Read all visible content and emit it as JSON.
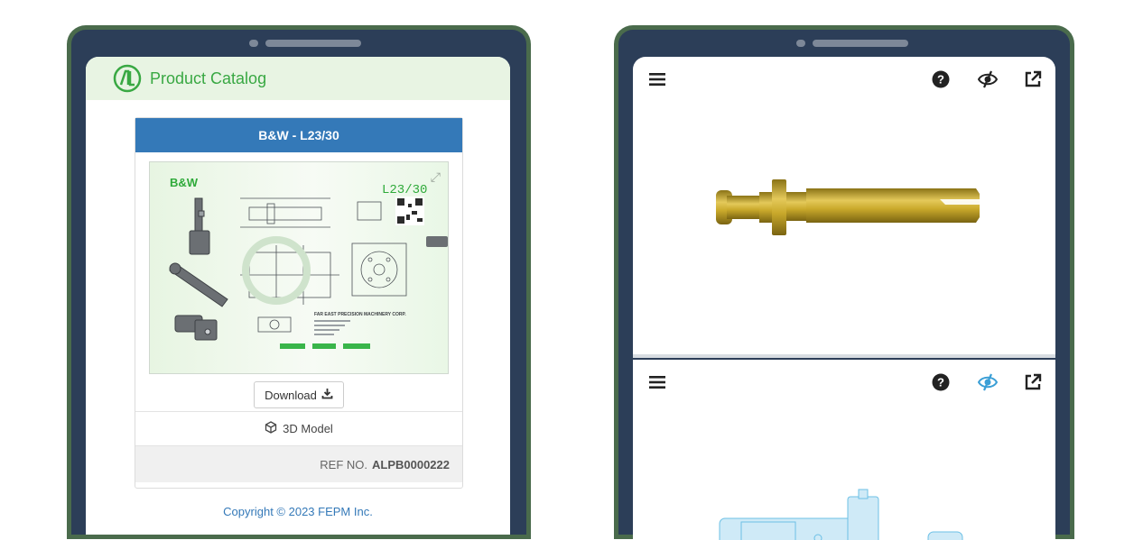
{
  "catalog": {
    "app_title": "Product Catalog",
    "product_title": "B&W - L23/30",
    "drawing": {
      "brand": "B&W",
      "model_code": "L23/30",
      "corner_text": "FAR EAST PRECISION MACHINERY CORP."
    },
    "download_label": "Download",
    "model_3d_label": "3D Model",
    "ref_label": "REF NO.",
    "ref_value": "ALPB0000222",
    "copyright": "Copyright © 2023 FEPM Inc."
  },
  "viewer": {
    "top": {
      "icons": [
        "menu-icon",
        "help-icon",
        "xray-eye-icon",
        "open-external-icon"
      ],
      "xray_active": false
    },
    "bottom": {
      "icons": [
        "menu-icon",
        "help-icon",
        "xray-eye-icon",
        "open-external-icon"
      ],
      "xray_active": true
    }
  },
  "colors": {
    "brand_green": "#39a843",
    "header_blue": "#3479b8",
    "device_frame": "#2c3e58",
    "xray_active": "#3b9fd6",
    "part_gold": "#c9a92b"
  }
}
